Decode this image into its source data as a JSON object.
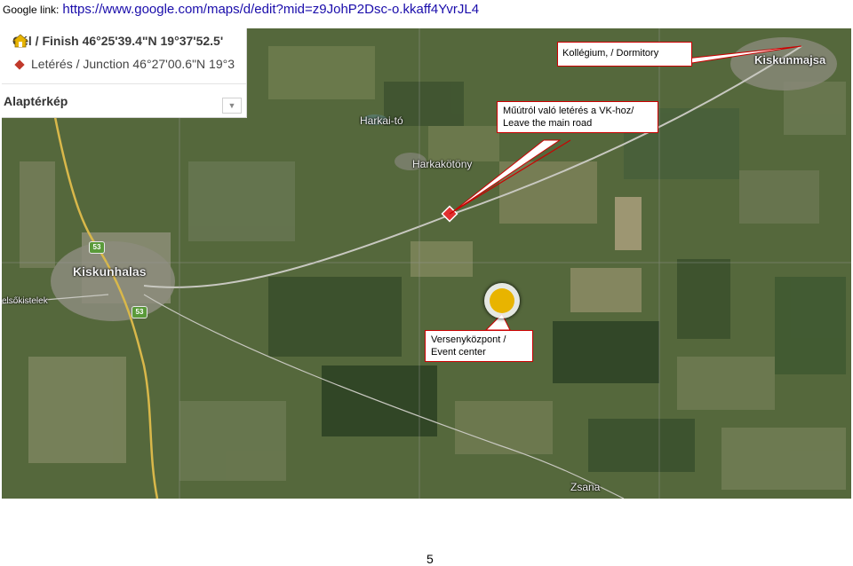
{
  "header": {
    "prefix": "Google link:",
    "url": "https://www.google.com/maps/d/edit?mid=z9JohP2Dsc-o.kkaff4YvrJL4"
  },
  "legend": {
    "finish": "Cél / Finish 46°25'39.4\"N 19°37'52.5'",
    "junction": "Letérés / Junction 46°27'00.6\"N 19°3",
    "basemap": "Alaptérkép"
  },
  "places": {
    "harkai_to": "Harkai-tó",
    "harkakotony": "Harkakötöny",
    "kiskunhalas": "Kiskunhalas",
    "kiskunmajsa": "Kiskunmajsa",
    "zsana": "Zsana",
    "kistelek": "elsőkistelek",
    "route_53_a": "53",
    "route_53_b": "53"
  },
  "callouts": {
    "dormitory": "Kollégium, / Dormitory",
    "junction_line1": "Műútról való letérés a VK-hoz/",
    "junction_line2": "Leave the main road",
    "event_line1": "Versenyközpont /",
    "event_line2": "Event center"
  },
  "colors": {
    "callout_border": "#cc0000",
    "junction_marker": "#e03030",
    "event_marker": "#e8b400",
    "road_main": "#d9b84a"
  },
  "page_number": "5"
}
